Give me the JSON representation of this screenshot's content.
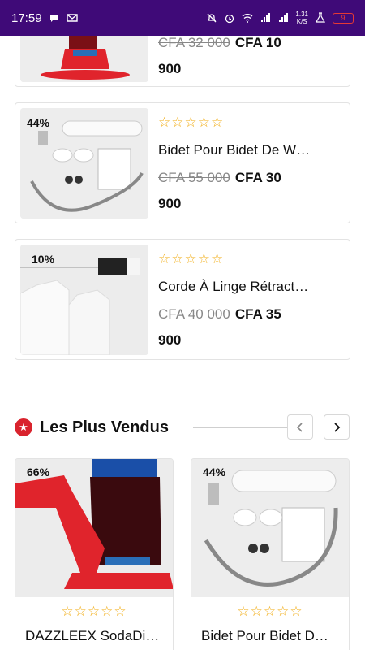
{
  "status_bar": {
    "time": "17:59",
    "net_speed_value": "1.31",
    "net_speed_unit": "K/S",
    "battery_level": "9"
  },
  "products_list": [
    {
      "discount": "",
      "old_price": "CFA 32 000",
      "new_price": "CFA 10",
      "price_tail": "900",
      "rating_stars": "☆☆☆☆☆",
      "name": "",
      "image": "soda-dispenser"
    },
    {
      "discount": "44%",
      "old_price": "CFA 55 000",
      "new_price": "CFA 30",
      "price_tail": "900",
      "rating_stars": "☆☆☆☆☆",
      "name": "Bidet Pour Bidet De W…",
      "image": "bidet-kit"
    },
    {
      "discount": "10%",
      "old_price": "CFA 40 000",
      "new_price": "CFA 35",
      "price_tail": "900",
      "rating_stars": "☆☆☆☆☆",
      "name": "Corde À Linge Rétract…",
      "image": "clothesline"
    }
  ],
  "best_sellers": {
    "title": "Les Plus Vendus",
    "items": [
      {
        "discount": "66%",
        "rating_stars": "☆☆☆☆☆",
        "name": "DAZZLEEX SodaDi…",
        "image": "soda-dispenser"
      },
      {
        "discount": "44%",
        "rating_stars": "☆☆☆☆☆",
        "name": "Bidet Pour Bidet D…",
        "image": "bidet-kit"
      }
    ]
  },
  "colors": {
    "status_bar": "#3f0a78",
    "star": "#f2b01e",
    "section_icon": "#d9232d"
  }
}
